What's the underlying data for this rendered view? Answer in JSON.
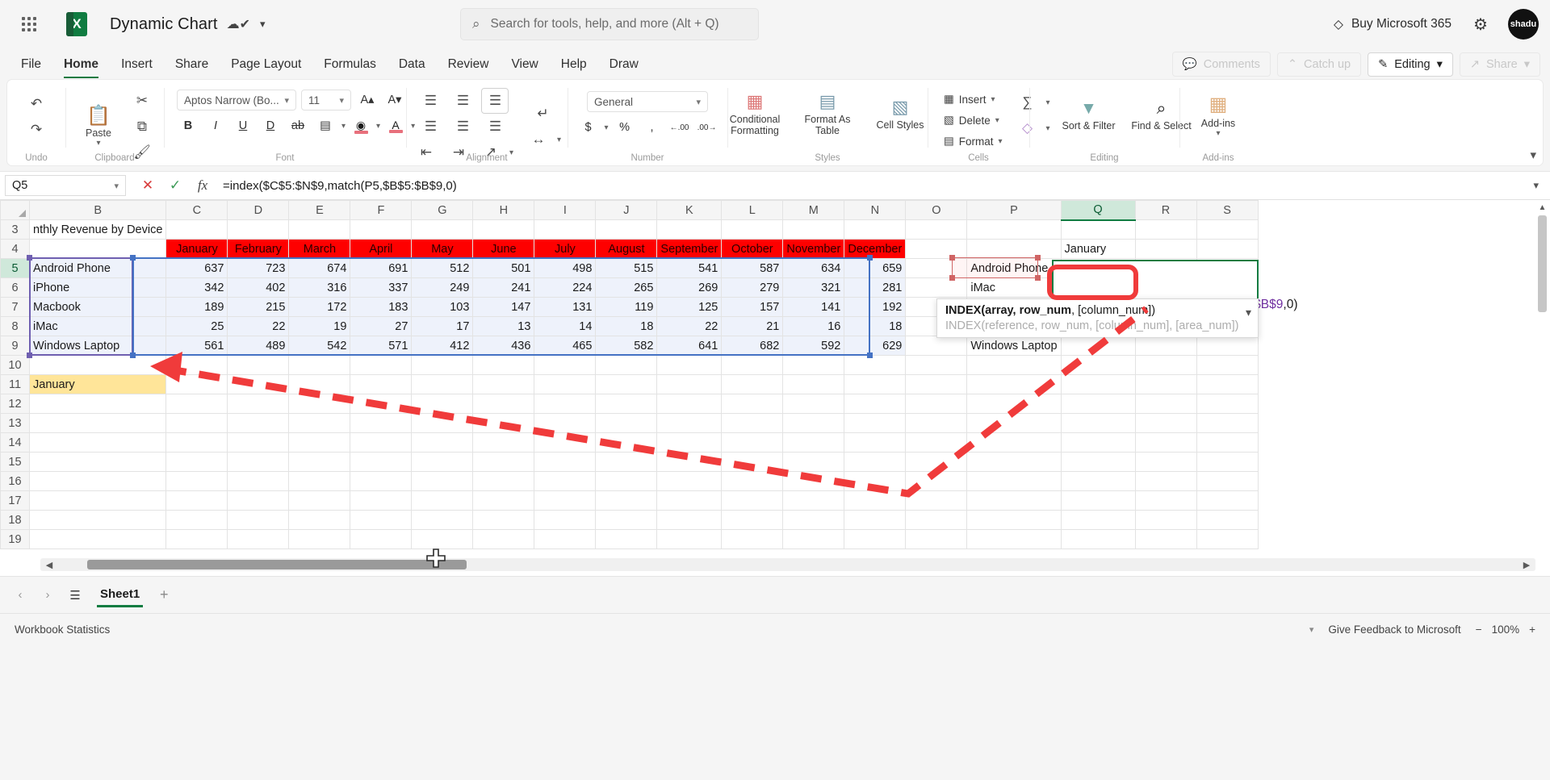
{
  "titlebar": {
    "doc_title": "Dynamic Chart",
    "autosave_icon": "autosave-cloud-icon",
    "search_placeholder": "Search for tools, help, and more (Alt + Q)",
    "buy_label": "Buy Microsoft 365",
    "avatar_initials": "shadu",
    "waffle_icon": "app-launcher-icon",
    "gear_icon": "settings-gear-icon",
    "diamond_icon": "diamond-icon"
  },
  "tabs": [
    {
      "label": "File",
      "active": false
    },
    {
      "label": "Home",
      "active": true
    },
    {
      "label": "Insert",
      "active": false
    },
    {
      "label": "Share",
      "active": false
    },
    {
      "label": "Page Layout",
      "active": false
    },
    {
      "label": "Formulas",
      "active": false
    },
    {
      "label": "Data",
      "active": false
    },
    {
      "label": "Review",
      "active": false
    },
    {
      "label": "View",
      "active": false
    },
    {
      "label": "Help",
      "active": false
    },
    {
      "label": "Draw",
      "active": false
    }
  ],
  "tabbar_right": {
    "comments": "Comments",
    "catch_up": "Catch up",
    "editing": "Editing",
    "share": "Share"
  },
  "ribbon": {
    "groups": [
      {
        "label": "Undo"
      },
      {
        "label": "Clipboard"
      },
      {
        "label": "Font"
      },
      {
        "label": "Alignment"
      },
      {
        "label": "Number"
      },
      {
        "label": "Styles"
      },
      {
        "label": "Cells"
      },
      {
        "label": "Editing"
      },
      {
        "label": "Add-ins"
      }
    ],
    "paste_label": "Paste",
    "font_name": "Aptos Narrow (Bo...",
    "font_size": "11",
    "number_format": "General",
    "conditional_formatting": "Conditional Formatting",
    "format_as_table": "Format As Table",
    "cell_styles": "Cell Styles",
    "insert": "Insert",
    "delete": "Delete",
    "format": "Format",
    "sort_filter": "Sort & Filter",
    "find_select": "Find & Select",
    "addins": "Add-ins"
  },
  "formula_bar": {
    "name_box": "Q5",
    "cancel_icon": "cancel-x-icon",
    "enter_icon": "enter-check-icon",
    "fx_icon": "insert-function-icon",
    "formula": "=index($C$5:$N$9,match(P5,$B$5:$B$9,0)"
  },
  "grid": {
    "columns": [
      "B",
      "C",
      "D",
      "E",
      "F",
      "G",
      "H",
      "I",
      "J",
      "K",
      "L",
      "M",
      "N",
      "O",
      "P",
      "Q",
      "R",
      "S"
    ],
    "selected_column": "Q",
    "rows": [
      "3",
      "4",
      "5",
      "6",
      "7",
      "8",
      "9",
      "10",
      "11",
      "12",
      "13",
      "14",
      "15",
      "16",
      "17",
      "18",
      "19"
    ],
    "selected_row": "5",
    "title_cell": "nthly Revenue by Device",
    "month_headers": [
      "January",
      "February",
      "March",
      "April",
      "May",
      "June",
      "July",
      "August",
      "September",
      "October",
      "November",
      "December"
    ],
    "device_rows": [
      {
        "device": "Android Phone",
        "values": [
          637,
          723,
          674,
          691,
          512,
          501,
          498,
          515,
          541,
          587,
          634,
          659
        ]
      },
      {
        "device": "iPhone",
        "values": [
          342,
          402,
          316,
          337,
          249,
          241,
          224,
          265,
          269,
          279,
          321,
          281
        ]
      },
      {
        "device": "Macbook",
        "values": [
          189,
          215,
          172,
          183,
          103,
          147,
          131,
          119,
          125,
          157,
          141,
          192
        ]
      },
      {
        "device": "iMac",
        "values": [
          25,
          22,
          19,
          27,
          17,
          13,
          14,
          18,
          22,
          21,
          16,
          18
        ]
      },
      {
        "device": "Windows Laptop",
        "values": [
          561,
          489,
          542,
          571,
          412,
          436,
          465,
          582,
          641,
          682,
          592,
          629
        ]
      }
    ],
    "lookup_cell_b11": "January",
    "lookup_list_p": [
      "Android Phone",
      "iMac",
      "Windows Laptop"
    ],
    "q4_month": "January",
    "header_fill": "#fe0000",
    "data_fill": "#eef2fb",
    "yellow_fill": "#ffe599"
  },
  "editing_cell": {
    "parts": [
      {
        "text": "=index(",
        "color": "dark"
      },
      {
        "text": "$C$5",
        "color": "blue-faded"
      },
      {
        "text": ":$N$9",
        "color": "blue"
      },
      {
        "text": ",match(",
        "color": "dark"
      },
      {
        "text": "P5",
        "color": "red"
      },
      {
        "text": ",$B$5:$B$9",
        "color": "purple"
      },
      {
        "text": ",0)",
        "color": "dark"
      }
    ],
    "plain": "=index($C$5:$N$9,match(P5,$B$5:$B$9,0)"
  },
  "intellisense": {
    "line1_prefix": "INDEX(array, ",
    "line1_bold": "row_num",
    "line1_suffix": ", [column_num])",
    "line2": "INDEX(reference, row_num, [column_num], [area_num])",
    "chevron_icon": "chevron-down-icon"
  },
  "sheetbar": {
    "prev_icon": "prev-sheet-icon",
    "next_icon": "next-sheet-icon",
    "list_icon": "sheet-list-icon",
    "sheet_name": "Sheet1",
    "add_icon": "add-sheet-icon"
  },
  "statusbar": {
    "workbook_statistics": "Workbook Statistics",
    "feedback": "Give Feedback to Microsoft",
    "zoom_out": "−",
    "zoom_level": "100%",
    "zoom_in": "+"
  },
  "annotation": {
    "color": "#f03b3b",
    "description": "dashed-arrow-callout"
  }
}
